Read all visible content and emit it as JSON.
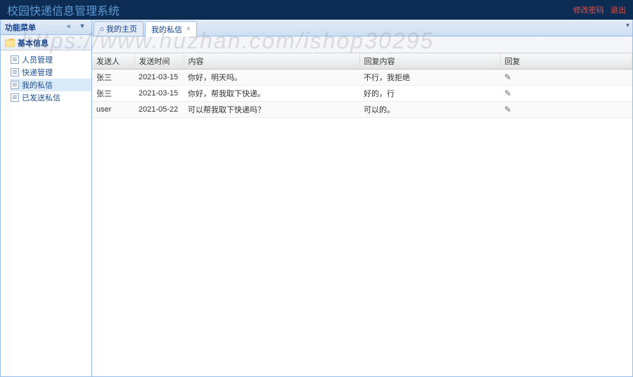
{
  "header": {
    "title": "校园快递信息管理系统",
    "link_pwd": "修改密码",
    "link_logout": "退出"
  },
  "sidebar": {
    "title": "功能菜单",
    "group_label": "基本信息",
    "items": [
      {
        "label": "人员管理"
      },
      {
        "label": "快递管理"
      },
      {
        "label": "我的私信"
      },
      {
        "label": "已发送私信"
      }
    ]
  },
  "tabs": {
    "home": "我的主页",
    "active": "我的私信"
  },
  "grid": {
    "columns": {
      "sender": "发送人",
      "time": "发送时间",
      "content": "内容",
      "reply_content": "回复内容",
      "reply": "回复"
    },
    "rows": [
      {
        "sender": "张三",
        "time": "2021-03-15",
        "content": "你好，明天吗。",
        "reply": "不行，我拒绝"
      },
      {
        "sender": "张三",
        "time": "2021-03-15",
        "content": "你好，帮我取下快递。",
        "reply": "好的，行"
      },
      {
        "sender": "user",
        "time": "2021-05-22",
        "content": "可以帮我取下快递吗？",
        "reply": "可以的。"
      }
    ]
  },
  "watermark": "https://www.huzhan.com/ishop30295"
}
